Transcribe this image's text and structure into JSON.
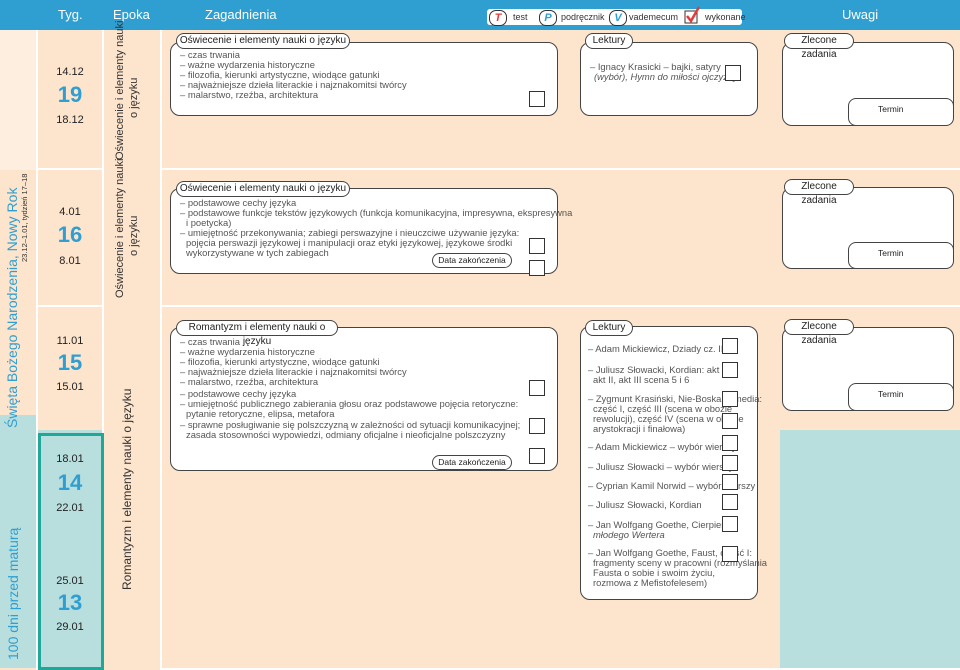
{
  "header": {
    "col_typ": "Tyg.",
    "col_epoka": "Epoka",
    "col_zagadnienia": "Zagadnienia",
    "col_uwagi": "Uwagi",
    "legend": [
      {
        "icon": "T",
        "label": "test",
        "color": "#e63a3a"
      },
      {
        "icon": "P",
        "label": "podręcznik",
        "color": "#2f9fd2"
      },
      {
        "icon": "V",
        "label": "vademecum",
        "color": "#2f9fd2"
      },
      {
        "icon": "check-icon",
        "label": "wykonane",
        "color": "#e63a3a"
      }
    ]
  },
  "side": {
    "countdown": "100 dni przed maturą",
    "holiday": "Święta Bożego Narodzenia, Nowy Rok",
    "holiday_dates": "23.12–1.01, tydzień 17–18"
  },
  "weeks": [
    {
      "start": "14.12",
      "num": "19",
      "end": "18.12"
    },
    {
      "start": "4.01",
      "num": "16",
      "end": "8.01"
    },
    {
      "start": "11.01",
      "num": "15",
      "end": "15.01"
    },
    {
      "start": "18.01",
      "num": "14",
      "end": "22.01"
    },
    {
      "start": "25.01",
      "num": "13",
      "end": "29.01"
    }
  ],
  "epochs": [
    {
      "line1": "Oświecenie i elementy nauki",
      "line2": "o języku"
    },
    {
      "line1": "Oświecenie i elementy nauki",
      "line2": "o języku"
    },
    {
      "line1": "Romantyzm i elementy nauki o języku"
    }
  ],
  "sections": [
    {
      "title": "Oświecenie i elementy nauki o języku",
      "topics": [
        "– czas trwania",
        "– ważne wydarzenia historyczne",
        "– filozofia, kierunki artystyczne, wiodące gatunki",
        "– najważniejsze dzieła literackie i najznakomitsi twórcy",
        "– malarstwo, rzeźba, architektura"
      ],
      "lektury_title": "Lektury",
      "lektury": [
        "– Ignacy Krasicki – bajki, satyry",
        "(wybór), Hymn do miłości ojczyzny"
      ],
      "zlecone": "Zlecone zadania",
      "termin": "Termin"
    },
    {
      "title": "Oświecenie i elementy nauki o języku",
      "topics": [
        "– podstawowe cechy języka",
        "– podstawowe funkcje tekstów językowych (funkcja komunikacyjna, impresywna, ekspresywna",
        "i poetycka)",
        "– umiejętność przekonywania; zabiegi perswazyjne i nieuczciwe używanie języka:",
        "pojęcia perswazji językowej i manipulacji oraz etyki językowej, językowe środki",
        "wykorzystywane w tych zabiegach"
      ],
      "data_zak": "Data zakończenia",
      "zlecone": "Zlecone zadania",
      "termin": "Termin"
    },
    {
      "title": "Romantyzm i elementy nauki o języku",
      "topics": [
        "– czas trwania",
        "– ważne wydarzenia historyczne",
        "– filozofia, kierunki artystyczne, wiodące gatunki",
        "– najważniejsze dzieła literackie i najznakomitsi twórcy",
        "– malarstwo, rzeźba, architektura",
        "– podstawowe cechy języka",
        "– umiejętność publicznego zabierania głosu oraz podstawowe pojęcia retoryczne:",
        "pytanie retoryczne, elipsa, metafora",
        "– sprawne posługiwanie się polszczyzną w zależności od sytuacji komunikacyjnej;",
        "zasada stosowności wypowiedzi, odmiany oficjalne i nieoficjalne polszczyzny"
      ],
      "data_zak": "Data zakończenia",
      "lektury_title": "Lektury",
      "lektury": [
        "– Adam Mickiewicz, Dziady cz. III",
        "– Juliusz Słowacki, Kordian: akt I,",
        "akt II, akt III scena 5 i 6",
        "– Zygmunt Krasiński, Nie-Boska komedia:",
        "część I, część III (scena w obozie",
        "rewolucji), część IV (scena w obozie",
        "arystokracji i finałowa)",
        "– Adam Mickiewicz – wybór wierszy",
        "– Juliusz Słowacki – wybór wierszy",
        "– Cyprian Kamil Norwid – wybór wierszy",
        "– Juliusz Słowacki, Kordian",
        "– Jan Wolfgang Goethe, Cierpienia",
        "młodego Wertera",
        "– Jan Wolfgang Goethe, Faust, część I:",
        "fragmenty sceny w pracowni (rozmyślania",
        "Fausta o sobie i swoim życiu,",
        "rozmowa z Mefistofelesem)"
      ],
      "zlecone": "Zlecone zadania",
      "termin": "Termin"
    }
  ]
}
